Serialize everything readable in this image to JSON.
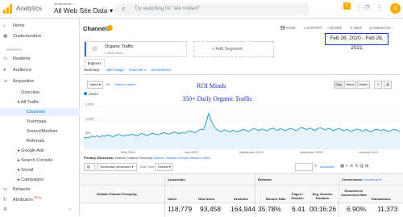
{
  "header": {
    "brand": "Analytics",
    "account_small": "All accounts > ...",
    "account": "All Web Site Data",
    "search_placeholder": "Try searching for \"site content\"",
    "notif_count": "1",
    "avatar_letter": "S"
  },
  "sidebar": {
    "home": "Home",
    "customization": "Customization",
    "reports_label": "REPORTS",
    "realtime": "Realtime",
    "audience": "Audience",
    "acquisition": "Acquisition",
    "overview": "Overview",
    "all_traffic": "All Traffic",
    "channels": "Channels",
    "treemaps": "Treemaps",
    "source_medium": "Source/Medium",
    "referrals": "Referrals",
    "google_ads": "Google Ads",
    "search_console": "Search Console",
    "social": "Social",
    "campaigns": "Campaigns",
    "behavior": "Behavior",
    "attribution": "Attribution",
    "beta": "BETA"
  },
  "main": {
    "title": "Channels",
    "actions": [
      "SAVE",
      "EXPORT",
      "SHARE",
      "EDIT",
      "INSIGHTS"
    ],
    "date_range": "Feb 26, 2020 - Feb 26, 2021",
    "segment_name": "Organic Traffic",
    "segment_sub": "2.85% Users",
    "add_segment": "+ Add Segment",
    "explorer_tab": "Explorer",
    "subtabs": [
      "Summary",
      "Site Usage",
      "Goal Set 1",
      "Ecommerce"
    ],
    "metric_select": "Users",
    "vs": "VS.",
    "select_metric": "Select a metric",
    "granularity": [
      "Day",
      "Week",
      "Month"
    ],
    "overlay_line1": "ROI Minds",
    "overlay_line2": "350+ Daily Organic Traffic",
    "primary_dimension_label": "Primary Dimension:",
    "primary_dimension_value": "Default Channel Grouping",
    "other_dimensions": "Source / Medium   Source   Medium   Other",
    "secondary_dimension": "Secondary dimension",
    "sort_type": "Sort Type:",
    "sort_default": "Default",
    "advanced": "advanced"
  },
  "table": {
    "group_acquisition": "Acquisition",
    "group_behavior": "Behavior",
    "group_conversions": "Conversions",
    "conversions_select": "eCommerce",
    "dim_header": "Default Channel Grouping",
    "columns": [
      "Users",
      "New Users",
      "Sessions",
      "Bounce Rate",
      "Pages / Session",
      "Avg. Session Duration",
      "Ecommerce Conversion Rate",
      "Transactions"
    ],
    "totals": [
      "118,779",
      "93,458",
      "164,944",
      "35.78%",
      "6.41",
      "00:16:26",
      "6.90%",
      "11,373"
    ]
  },
  "chart_data": {
    "type": "line",
    "series": [
      {
        "name": "Users",
        "color": "#058dc7"
      }
    ],
    "y_ticks": [
      "1,500",
      "1,000",
      "500"
    ],
    "ylim": [
      0,
      1800
    ],
    "x_ticks": [
      "May 2020",
      "July 2020",
      "September 2020",
      "November 2020",
      "January 2021"
    ],
    "values": [
      380,
      420,
      400,
      460,
      430,
      470,
      420,
      480,
      450,
      500,
      470,
      440,
      480,
      520,
      490,
      460,
      510,
      480,
      530,
      500,
      470,
      520,
      550,
      510,
      480,
      530,
      560,
      520,
      500,
      540,
      580,
      550,
      520,
      560,
      600,
      570,
      540,
      590,
      560,
      610,
      650,
      600,
      580,
      640,
      700,
      680,
      900,
      1250,
      1000,
      800,
      700,
      650,
      620,
      680,
      640,
      600,
      660,
      630,
      610,
      650,
      700,
      660,
      620,
      680,
      720,
      690,
      650,
      710,
      680,
      640,
      700,
      740,
      700,
      660,
      720,
      690,
      650,
      700,
      730,
      690,
      650,
      710,
      760,
      720,
      680,
      740,
      700,
      660,
      720,
      750,
      710,
      670,
      730,
      700,
      650,
      690,
      720,
      680,
      640,
      700,
      660,
      620,
      680,
      710,
      670,
      630,
      690,
      650,
      600,
      660,
      700,
      680,
      640,
      690,
      650,
      610,
      670,
      700,
      660,
      620
    ]
  }
}
